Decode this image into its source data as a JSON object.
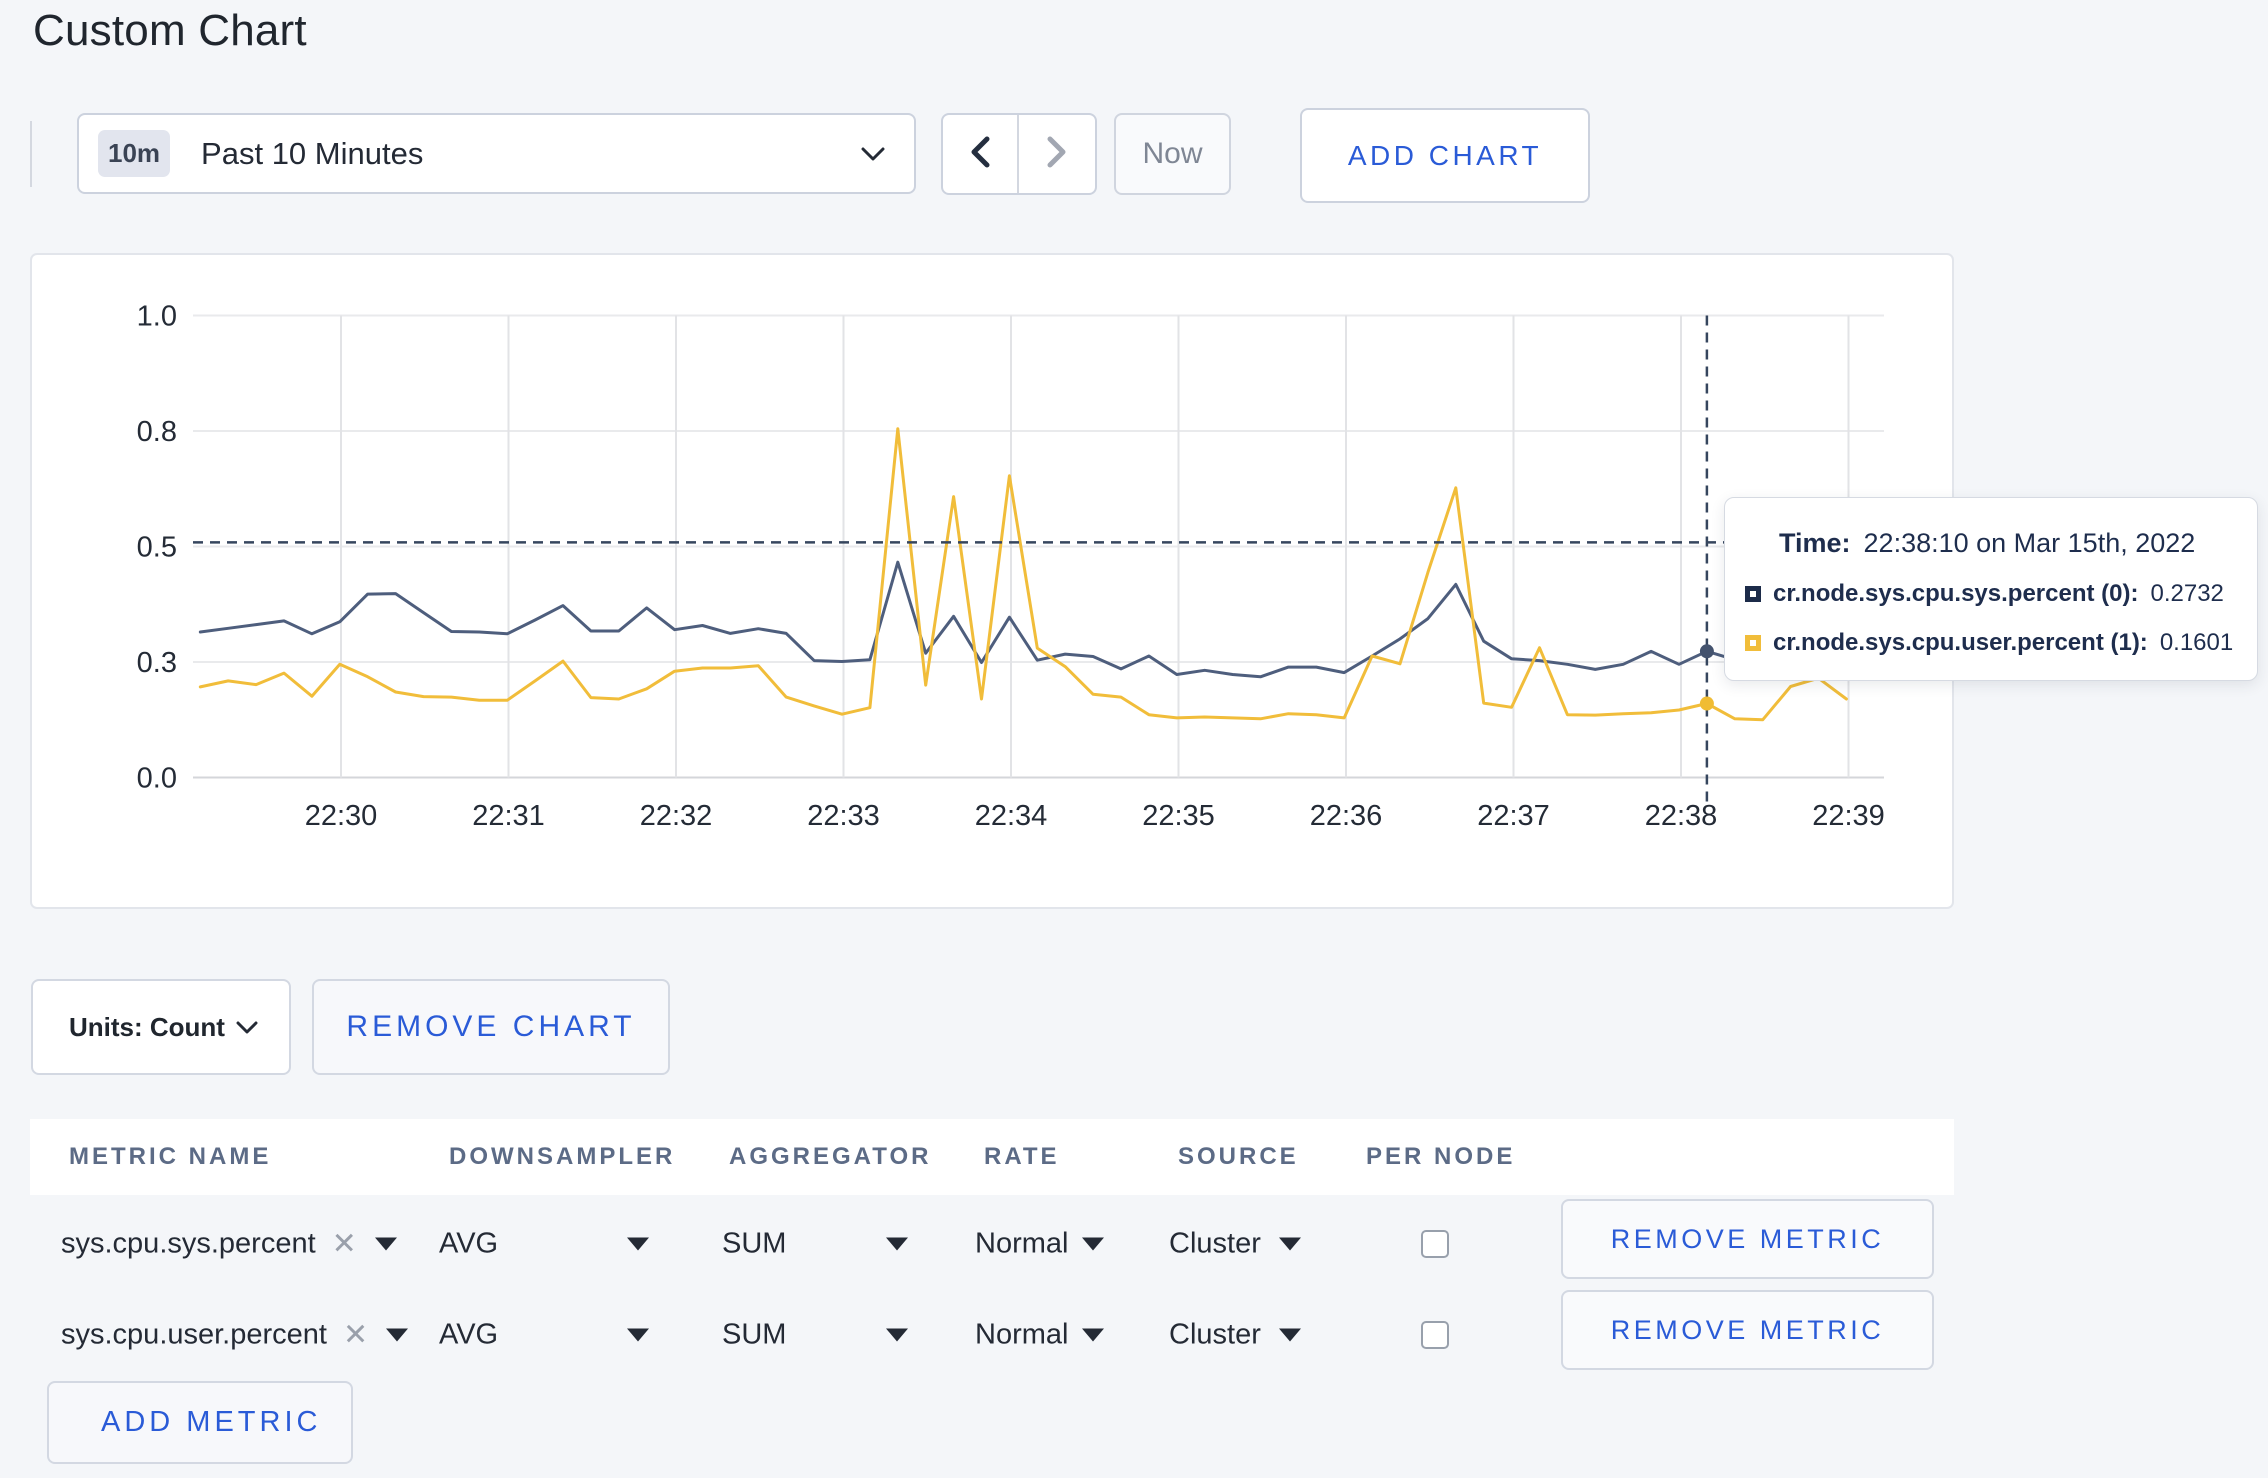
{
  "page": {
    "title": "Custom Chart"
  },
  "toolbar": {
    "range_badge": "10m",
    "range_label": "Past 10 Minutes",
    "now_label": "Now",
    "add_chart_label": "ADD CHART"
  },
  "chart_data": {
    "type": "line",
    "title": "",
    "xlabel": "",
    "ylabel": "",
    "ylim": [
      0,
      1
    ],
    "grid": true,
    "y_tick_values": [
      0,
      0.25,
      0.5,
      0.75,
      1.0
    ],
    "y_tick_labels": [
      "0.0",
      "0.3",
      "0.5",
      "0.8",
      "1.0"
    ],
    "x_tick_labels": [
      "22:30",
      "22:31",
      "22:32",
      "22:33",
      "22:34",
      "22:35",
      "22:36",
      "22:37",
      "22:38",
      "22:39"
    ],
    "start_time": "22:29:10",
    "interval_seconds": 10,
    "series": [
      {
        "name": "cr.node.sys.cpu.sys.percent (0)",
        "color": "#4e5e7d",
        "values": [
          0.315,
          0.323,
          0.331,
          0.339,
          0.311,
          0.337,
          0.397,
          0.398,
          0.357,
          0.316,
          0.315,
          0.311,
          0.341,
          0.372,
          0.317,
          0.317,
          0.367,
          0.32,
          0.329,
          0.312,
          0.322,
          0.312,
          0.253,
          0.251,
          0.255,
          0.466,
          0.269,
          0.349,
          0.249,
          0.347,
          0.254,
          0.267,
          0.262,
          0.235,
          0.263,
          0.223,
          0.232,
          0.223,
          0.218,
          0.239,
          0.239,
          0.227,
          0.263,
          0.3,
          0.344,
          0.418,
          0.295,
          0.257,
          0.253,
          0.245,
          0.234,
          0.245,
          0.273,
          0.245,
          0.2732,
          0.255,
          0.252,
          0.262,
          0.268,
          0.26
        ]
      },
      {
        "name": "cr.node.sys.cpu.user.percent (1)",
        "color": "#f1bd3a",
        "values": [
          0.196,
          0.209,
          0.201,
          0.226,
          0.176,
          0.245,
          0.218,
          0.185,
          0.175,
          0.174,
          0.167,
          0.167,
          0.209,
          0.252,
          0.173,
          0.17,
          0.192,
          0.23,
          0.237,
          0.237,
          0.242,
          0.174,
          0.155,
          0.137,
          0.151,
          0.755,
          0.2,
          0.608,
          0.17,
          0.653,
          0.28,
          0.24,
          0.18,
          0.174,
          0.136,
          0.129,
          0.131,
          0.129,
          0.127,
          0.138,
          0.136,
          0.129,
          0.263,
          0.246,
          0.444,
          0.627,
          0.161,
          0.152,
          0.281,
          0.136,
          0.135,
          0.138,
          0.14,
          0.146,
          0.1601,
          0.127,
          0.125,
          0.197,
          0.215,
          0.17
        ]
      }
    ],
    "legend_position": "tooltip",
    "crosshair": {
      "x_index": 54,
      "time": "22:38:10",
      "y_value": 0.509
    },
    "hover_points": [
      {
        "series": 0,
        "value": 0.2732
      },
      {
        "series": 1,
        "value": 0.1601
      }
    ]
  },
  "tooltip": {
    "time_label": "Time:",
    "time_value": "22:38:10 on Mar 15th, 2022",
    "rows": [
      {
        "label": "cr.node.sys.cpu.sys.percent (0):",
        "value": "0.2732",
        "color": "#1c2b49"
      },
      {
        "label": "cr.node.sys.cpu.user.percent (1):",
        "value": "0.1601",
        "color": "#f1bd3a"
      }
    ]
  },
  "chart_controls": {
    "units_label": "Units: Count",
    "remove_chart_label": "REMOVE CHART"
  },
  "metrics_table": {
    "columns": [
      "METRIC NAME",
      "DOWNSAMPLER",
      "AGGREGATOR",
      "RATE",
      "SOURCE",
      "PER NODE"
    ],
    "rows": [
      {
        "metric": "sys.cpu.sys.percent",
        "downsampler": "AVG",
        "aggregator": "SUM",
        "rate": "Normal",
        "source": "Cluster",
        "per_node_checked": false,
        "remove_label": "REMOVE METRIC"
      },
      {
        "metric": "sys.cpu.user.percent",
        "downsampler": "AVG",
        "aggregator": "SUM",
        "rate": "Normal",
        "source": "Cluster",
        "per_node_checked": false,
        "remove_label": "REMOVE METRIC"
      }
    ],
    "add_metric_label": "ADD METRIC"
  },
  "colors": {
    "accent_blue": "#2a5bd7",
    "page_background": "#f4f6f9",
    "crosshair": "#36465e"
  }
}
